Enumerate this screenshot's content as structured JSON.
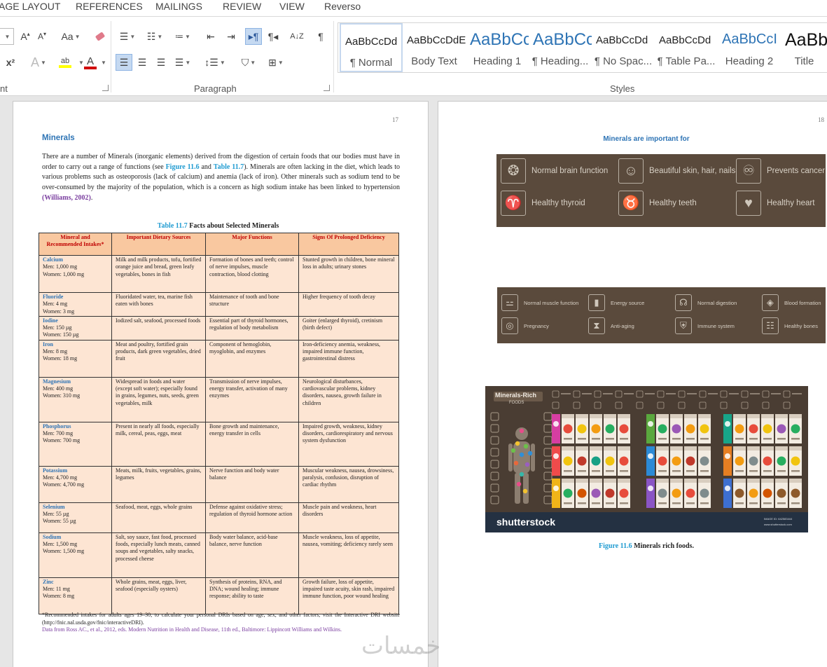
{
  "tabs": [
    "AGE LAYOUT",
    "REFERENCES",
    "MAILINGS",
    "REVIEW",
    "VIEW",
    "Reverso"
  ],
  "groups": {
    "font": "nt",
    "paragraph": "Paragraph",
    "styles": "Styles"
  },
  "font_tools": {
    "grow": "A",
    "shrink": "A",
    "case": "Aa",
    "superscript": "x²",
    "effects": "A",
    "highlight": "ab",
    "color": "A"
  },
  "styles": [
    {
      "preview": "AaBbCcDd",
      "name": "¶ Normal"
    },
    {
      "preview": "AaBbCcDdE",
      "name": "Body Text"
    },
    {
      "preview": "AaBbCc",
      "name": "Heading 1"
    },
    {
      "preview": "AaBbCc",
      "name": "¶ Heading..."
    },
    {
      "preview": "AaBbCcDd",
      "name": "¶ No Spac..."
    },
    {
      "preview": "AaBbCcDd",
      "name": "¶ Table Pa..."
    },
    {
      "preview": "AaBbCcI",
      "name": "Heading 2"
    },
    {
      "preview": "AaBb",
      "name": "Title"
    }
  ],
  "colors": {
    "heading_blue": "#2e74b5",
    "ref_blue": "#1f9bd1",
    "cite_purple": "#7b3fa0",
    "table_header": "#f9c8a0",
    "table_cell": "#fde5d3",
    "banner_brown": "#5a4a3c"
  },
  "page17": {
    "number": "17",
    "heading": "Minerals",
    "para": {
      "p1": "There are a number of Minerals (inorganic elements) derived from the digestion of certain foods that our bodies must have in order to carry out a range of functions (see ",
      "ref1": "Figure 11.6",
      "p2": " and ",
      "ref2": "Table 11.7",
      "p3": "). Minerals are often lacking in the diet, which leads to various problems such as osteoporosis (lack of calcium) and anemia (lack of iron). Other minerals such as sodium tend to be over-consumed by the majority of the population, which is a concern as high sodium intake has been linked to hypertension ",
      "cite": "(Williams, 2002)",
      "p4": "."
    },
    "table_caption": {
      "num": "Table 11.7",
      "title": " Facts about Selected Minerals"
    },
    "table_headers": [
      "Mineral and Recommended Intakes*",
      "Important Dietary Sources",
      "Major Functions",
      "Signs Of Prolonged Deficiency"
    ],
    "table_rows": [
      {
        "name": "Calcium",
        "men": "Men: 1,000 mg",
        "women": "Women: 1,000 mg",
        "sources": "Milk and milk products, tofu, fortified orange juice and bread, green leafy vegetables, bones in fish",
        "functions": "Formation of bones and teeth; control of nerve impulses, muscle contraction, blood clotting",
        "deficiency": "Stunted growth in children, bone mineral loss in adults; urinary stones"
      },
      {
        "name": "Fluoride",
        "men": "Men: 4 mg",
        "women": "Women: 3 mg",
        "sources": "Fluoridated water, tea, marine fish eaten with bones",
        "functions": "Maintenance of tooth and bone structure",
        "deficiency": "Higher frequency of tooth decay"
      },
      {
        "name": "Iodine",
        "men": "Men: 150 µg",
        "women": "Women: 150 µg",
        "sources": "Iodized salt, seafood, processed foods",
        "functions": "Essential part of thyroid hormones, regulation of body metabolism",
        "deficiency": "Goiter (enlarged thyroid), cretinism (birth defect)"
      },
      {
        "name": "Iron",
        "men": "Men: 8 mg",
        "women": "Women: 18 mg",
        "sources": "Meat and poultry, fortified grain products, dark green vegetables, dried fruit",
        "functions": "Component of hemoglobin, myoglobin, and enzymes",
        "deficiency": "Iron-deficiency anemia, weakness, impaired immune function, gastrointestinal distress"
      },
      {
        "name": "Magnesium",
        "men": "Men: 400 mg",
        "women": "Women: 310 mg",
        "sources": "Widespread in foods and water (except soft water); especially found in grains, legumes, nuts, seeds, green vegetables, milk",
        "functions": "Transmission of nerve impulses, energy transfer, activation of many enzymes",
        "deficiency": "Neurological disturbances, cardiovascular problems, kidney disorders, nausea, growth failure in children"
      },
      {
        "name": "Phosphorus",
        "men": "Men: 700 mg",
        "women": "Women: 700 mg",
        "sources": "Present in nearly all foods, especially milk, cereal, peas, eggs, meat",
        "functions": "Bone growth and maintenance, energy transfer in cells",
        "deficiency": "Impaired growth, weakness, kidney disorders, cardiorespiratory and nervous system dysfunction"
      },
      {
        "name": "Potassium",
        "men": "Men: 4,700 mg",
        "women": "Women: 4,700 mg",
        "sources": "Meats, milk, fruits, vegetables, grains, legumes",
        "functions": "Nerve function and body water balance",
        "deficiency": "Muscular weakness, nausea, drowsiness, paralysis, confusion, disruption of cardiac rhythm"
      },
      {
        "name": "Selenium",
        "men": "Men: 55 µg",
        "women": "Women: 55 µg",
        "sources": "Seafood, meat, eggs, whole grains",
        "functions": "Defense against oxidative stress; regulation of thyroid hormone action",
        "deficiency": "Muscle pain and weakness, heart disorders"
      },
      {
        "name": "Sodium",
        "men": "Men: 1,500 mg",
        "women": "Women: 1,500 mg",
        "sources": "Salt, soy sauce, fast food, processed foods, especially lunch meats, canned soups and vegetables, salty snacks, processed cheese",
        "functions": "Body water balance, acid-base balance, nerve function",
        "deficiency": "Muscle weakness, loss of appetite, nausea, vomiting; deficiency rarely seen"
      },
      {
        "name": "Zinc",
        "men": "Men: 11 mg",
        "women": "Women: 8 mg",
        "sources": "Whole grains, meat, eggs, liver, seafood (especially oysters)",
        "functions": "Synthesis of proteins, RNA, and DNA; wound healing; immune response; ability to taste",
        "deficiency": "Growth failure, loss of appetite, impaired taste acuity, skin rash, impaired immune function, poor wound healing"
      }
    ],
    "footnote": "*Recommended intakes for adults ages 19–30; to calculate your personal DRIs based on age, sex, and other factors, visit the Interactive DRI website (http://fnic.nal.usda.gov/fnic/interactiveDRI).",
    "source": "Data from Ross AC., et al., 2012, eds. Modern Nutrition in Health and Disease, 11th ed., Baltimore: Lippincott Williams and Wilkins."
  },
  "page18": {
    "number": "18",
    "heading": "Minerals are important for",
    "banner1": [
      {
        "label": "Normal brain function",
        "icon": "brain-icon"
      },
      {
        "label": "Beautiful skin, hair, nails",
        "icon": "face-icon"
      },
      {
        "label": "Prevents cancer",
        "icon": "ribbon-icon"
      },
      {
        "label": "Healthy thyroid",
        "icon": "thyroid-icon"
      },
      {
        "label": "Healthy teeth",
        "icon": "tooth-icon"
      },
      {
        "label": "Healthy heart",
        "icon": "heart-icon"
      }
    ],
    "banner2": [
      {
        "label": "Normal muscle function",
        "icon": "dumbbell-icon"
      },
      {
        "label": "Energy source",
        "icon": "battery-icon"
      },
      {
        "label": "Normal digestion",
        "icon": "stomach-icon"
      },
      {
        "label": "Blood formation",
        "icon": "drop-icon"
      },
      {
        "label": "Pregnancy",
        "icon": "fetus-icon"
      },
      {
        "label": "Anti-aging",
        "icon": "hourglass-icon"
      },
      {
        "label": "Immune system",
        "icon": "shield-icon"
      },
      {
        "label": "Healthy bones",
        "icon": "bone-icon"
      }
    ],
    "image": {
      "title": "Minerals-Rich",
      "subtitle": "FOODS",
      "brand": "shutterstock",
      "image_id": "IMAGE ID: 642583444",
      "site": "www.shutterstock.com"
    },
    "figure_caption": {
      "num": "Figure 11.6",
      "title": " Minerals rich foods."
    }
  },
  "watermark": "خمسات"
}
